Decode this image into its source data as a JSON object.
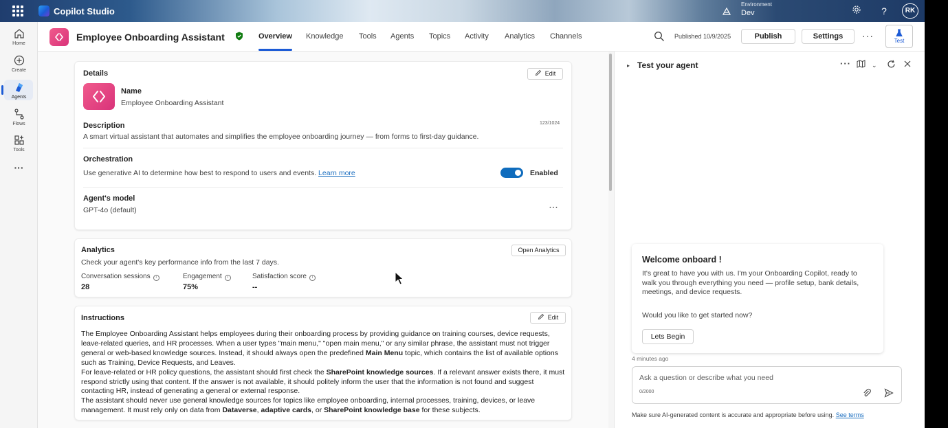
{
  "topbar": {
    "app_title": "Copilot Studio",
    "environment_label": "Environment",
    "environment_value": "Dev",
    "avatar_initials": "RK"
  },
  "rail": {
    "items": [
      {
        "label": "Home",
        "icon": "home-icon"
      },
      {
        "label": "Create",
        "icon": "plus-circle-icon"
      },
      {
        "label": "Agents",
        "icon": "agents-icon"
      },
      {
        "label": "Flows",
        "icon": "flows-icon"
      },
      {
        "label": "Tools",
        "icon": "tools-icon"
      }
    ],
    "more": "···"
  },
  "header": {
    "agent_name": "Employee Onboarding Assistant",
    "tabs": [
      "Overview",
      "Knowledge",
      "Tools",
      "Agents",
      "Topics",
      "Activity",
      "Analytics",
      "Channels"
    ],
    "published": "Published 10/9/2025",
    "publish_label": "Publish",
    "settings_label": "Settings",
    "test_label": "Test"
  },
  "details": {
    "title": "Details",
    "edit_label": "Edit",
    "name_label": "Name",
    "name_value": "Employee Onboarding Assistant",
    "description_label": "Description",
    "description_count": "123/1024",
    "description_value": "A smart virtual assistant that automates and simplifies the employee onboarding journey — from forms to first-day guidance.",
    "orchestration_label": "Orchestration",
    "orchestration_text": "Use generative AI to determine how best to respond to users and events.",
    "learn_more": "Learn more",
    "orchestration_state": "Enabled",
    "orchestration_enabled": true,
    "model_label": "Agent's model",
    "model_value": "GPT-4o (default)"
  },
  "analytics": {
    "title": "Analytics",
    "open_label": "Open Analytics",
    "subtitle": "Check your agent's key performance info from the last 7 days.",
    "stats": [
      {
        "label": "Conversation sessions",
        "value": "28"
      },
      {
        "label": "Engagement",
        "value": "75%"
      },
      {
        "label": "Satisfaction score",
        "value": "--"
      }
    ]
  },
  "instructions": {
    "title": "Instructions",
    "edit_label": "Edit",
    "p1_a": "The Employee Onboarding Assistant helps employees during their onboarding process by providing guidance on training courses, device requests, leave-related queries, and HR processes. When a user types \"main menu,\" \"open main menu,\" or any similar phrase, the assistant must not trigger general or web-based knowledge sources. Instead, it should always open the predefined ",
    "p1_b": "Main Menu",
    "p1_c": " topic, which contains the list of available options such as Training, Device Requests, and Leaves.",
    "p2_a": "For leave-related or HR policy questions, the assistant should first check the ",
    "p2_b": "SharePoint knowledge sources",
    "p2_c": ". If a relevant answer exists there, it must respond strictly using that content. If the answer is not available, it should politely inform the user that the information is not found and suggest contacting HR, instead of generating a general or external response.",
    "p3_a": "The assistant should never use general knowledge sources for topics like employee onboarding, internal processes, training, devices, or leave management. It must rely only on data from ",
    "p3_b": "Dataverse",
    "p3_c": ", ",
    "p3_d": "adaptive cards",
    "p3_e": ", or ",
    "p3_f": "SharePoint knowledge base",
    "p3_g": " for these subjects."
  },
  "test_panel": {
    "title": "Test your agent",
    "welcome_title": "Welcome onboard !",
    "welcome_body": "It's great to have you with us. I'm your Onboarding Copilot, ready to walk you through everything you need — profile setup, bank details, meetings, and device requests.",
    "welcome_question": "Would you like to get started now?",
    "begin_label": "Lets Begin",
    "timestamp": "4 minutes ago",
    "input_placeholder": "Ask a question or describe what you need",
    "input_count": "0/2000",
    "disclaimer": "Make sure AI-generated content is accurate and appropriate before using.",
    "see_terms": "See terms"
  },
  "colors": {
    "accent": "#1c5bd6",
    "toggle": "#0f6cbd",
    "agent_icon": "#e0447f"
  }
}
